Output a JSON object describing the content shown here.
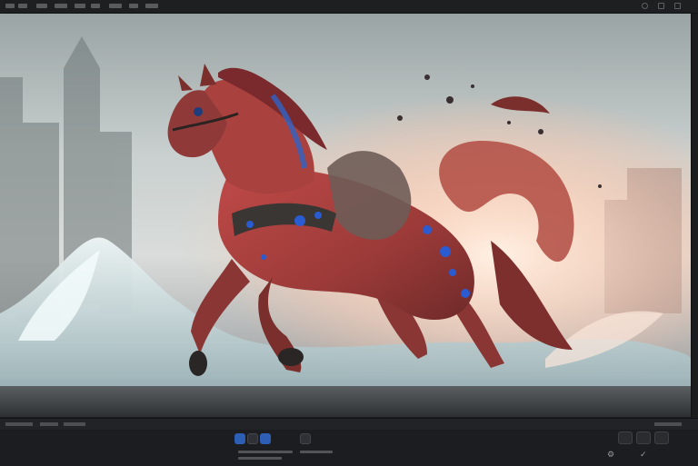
{
  "colors": {
    "accent": "#2c5fb3",
    "panel": "#1c1d20",
    "horse_red": "#a8403d",
    "spot_blue": "#2a5bd0"
  },
  "icons": [
    "settings-icon",
    "close-icon",
    "play-icon",
    "record-icon",
    "check-icon"
  ]
}
